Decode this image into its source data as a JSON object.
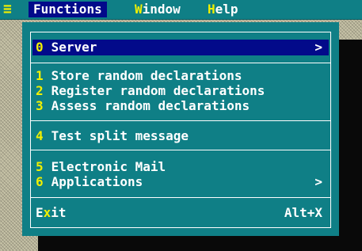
{
  "menubar": {
    "system_icon": "≡",
    "items": [
      {
        "hotkey": "F",
        "rest": "unctions",
        "active": true
      },
      {
        "hotkey": "W",
        "rest": "indow",
        "active": false
      },
      {
        "hotkey": "H",
        "rest": "elp",
        "active": false
      }
    ]
  },
  "dropdown": {
    "server": {
      "num": "0",
      "label": "Server",
      "arrow": ">"
    },
    "group1": [
      {
        "num": "1",
        "label": "Store random declarations"
      },
      {
        "num": "2",
        "label": "Register random declarations"
      },
      {
        "num": "3",
        "label": "Assess random declarations"
      }
    ],
    "group2": [
      {
        "num": "4",
        "label": "Test split message"
      }
    ],
    "group3": [
      {
        "num": "5",
        "label": "Electronic Mail"
      },
      {
        "num": "6",
        "label": "Applications",
        "arrow": ">"
      }
    ],
    "exit": {
      "hotkey": "x",
      "prefix": "E",
      "suffix": "it",
      "accelerator": "Alt+X"
    }
  },
  "colors": {
    "teal": "#0f7f86",
    "navy": "#020a8a",
    "yellow": "#f2f000",
    "white": "#ffffff"
  },
  "icons": {
    "system": "system-menu-icon",
    "submenu": "chevron-right-icon"
  }
}
